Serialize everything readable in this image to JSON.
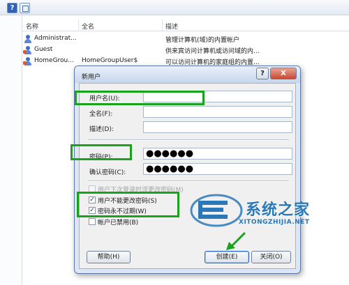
{
  "columns": {
    "name": "名称",
    "fullname": "全名",
    "description": "描述"
  },
  "users": [
    {
      "name": "Administrat...",
      "fullname": "",
      "description": "管理计算机(域)的内置帐户"
    },
    {
      "name": "Guest",
      "fullname": "",
      "description": "供来宾访问计算机或访问域的内..."
    },
    {
      "name": "HomeGrou...",
      "fullname": "HomeGroupUser$",
      "description": "可以访问计算机的家庭组的内置..."
    }
  ],
  "dialog": {
    "title": "新用户",
    "help_glyph": "?",
    "close_glyph": "X",
    "username_label": "用户名(U):",
    "username_value": "",
    "fullname_label": "全名(F):",
    "fullname_value": "",
    "description_label": "描述(D):",
    "description_value": "",
    "password_label": "密码(P):",
    "password_value": "●●●●●●",
    "confirm_label": "确认密码(C):",
    "confirm_value": "●●●●●●",
    "options": [
      {
        "label": "用户下次登录时须更改密码(M)",
        "checked": false,
        "enabled": false
      },
      {
        "label": "用户不能更改密码(S)",
        "checked": true,
        "enabled": true
      },
      {
        "label": "密码永不过期(W)",
        "checked": true,
        "enabled": true
      },
      {
        "label": "帐户已禁用(B)",
        "checked": false,
        "enabled": true
      }
    ],
    "help_button": "帮助(H)",
    "create_button": "创建(E)",
    "close_button": "关闭(O)"
  },
  "watermark": {
    "brand": "系统之家",
    "url": "XITONGZHIJIA.NET"
  },
  "colors": {
    "annotation": "#19a31b",
    "dialog_frame": "#dce6f4",
    "watermark": "#2a78b8"
  }
}
